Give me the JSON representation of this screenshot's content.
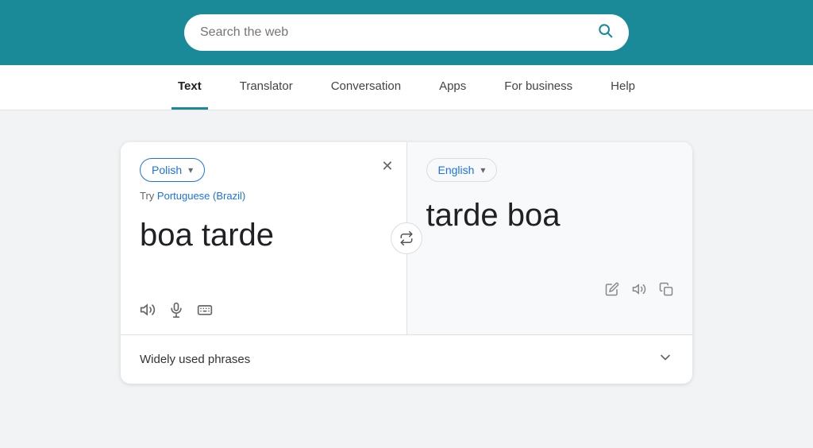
{
  "header": {
    "search_placeholder": "Search the web",
    "background_color": "#1a8a99"
  },
  "nav": {
    "items": [
      {
        "id": "text",
        "label": "Text",
        "active": true
      },
      {
        "id": "translator",
        "label": "Translator",
        "active": false
      },
      {
        "id": "conversation",
        "label": "Conversation",
        "active": false
      },
      {
        "id": "apps",
        "label": "Apps",
        "active": false
      },
      {
        "id": "for-business",
        "label": "For business",
        "active": false
      },
      {
        "id": "help",
        "label": "Help",
        "active": false
      }
    ]
  },
  "translator": {
    "source_lang": "Polish",
    "target_lang": "English",
    "suggestion_prefix": "Try",
    "suggestion_link": "Portuguese (Brazil)",
    "source_text": "boa tarde",
    "target_text": "tarde boa",
    "phrases_label": "Widely used phrases",
    "icons": {
      "speaker": "🔊",
      "mic": "🎤",
      "keyboard": "⌨",
      "edit": "✏",
      "speaker2": "🔊",
      "copy": "⧉",
      "swap": "⇄",
      "clear": "✕",
      "chevron_down": "∨",
      "arrow_down": "▾"
    }
  }
}
